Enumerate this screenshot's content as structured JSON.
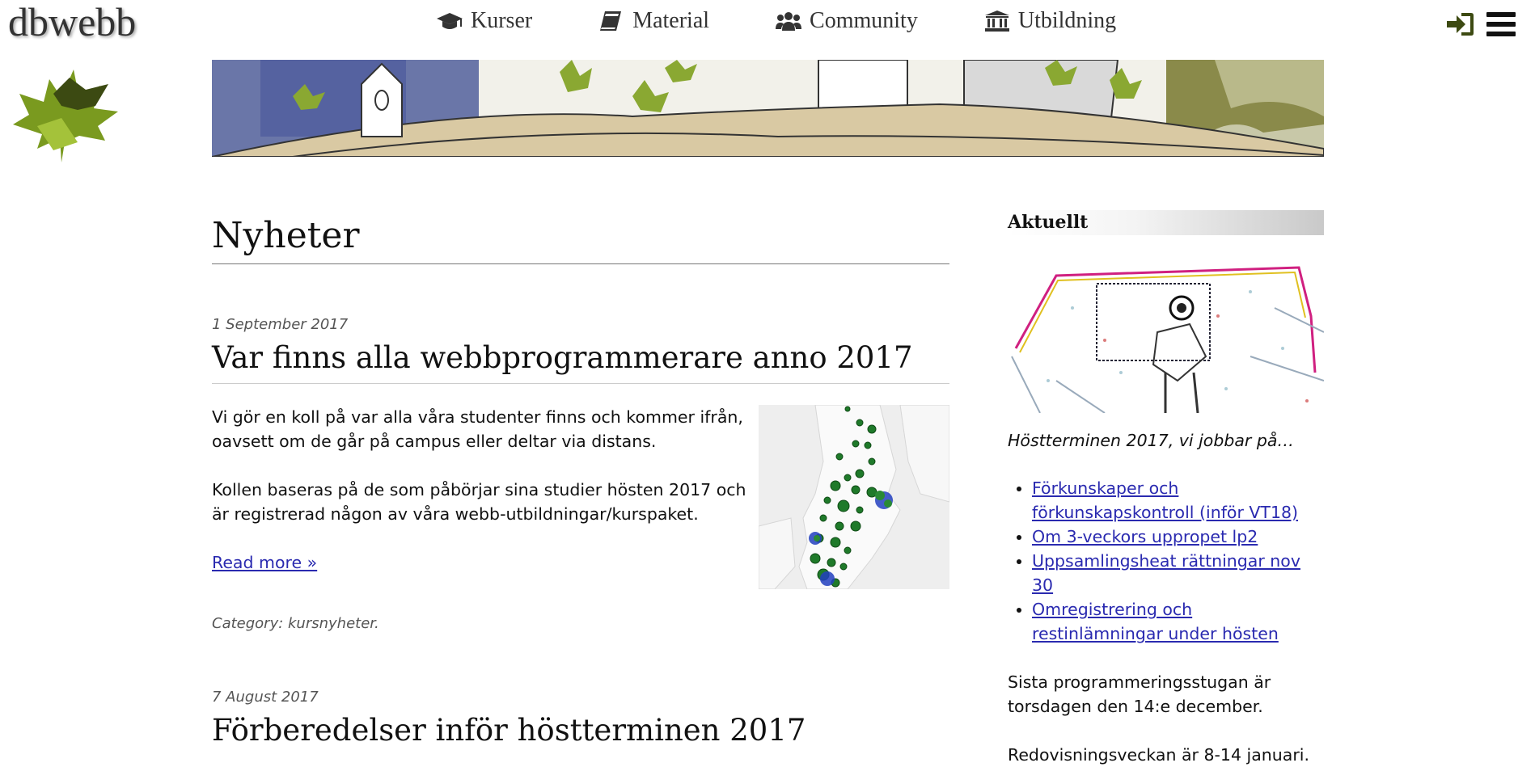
{
  "site": {
    "logo_text": "dbwebb"
  },
  "nav": {
    "items": [
      {
        "label": "Kurser",
        "icon": "graduation-cap-icon"
      },
      {
        "label": "Material",
        "icon": "book-icon"
      },
      {
        "label": "Community",
        "icon": "users-icon"
      },
      {
        "label": "Utbildning",
        "icon": "university-icon"
      }
    ]
  },
  "main": {
    "page_title": "Nyheter",
    "posts": [
      {
        "date": "1 September 2017",
        "title": "Var finns alla webbprogrammerare anno 2017",
        "paragraphs": [
          "Vi gör en koll på var alla våra studenter finns och kommer ifrån, oavsett om de går på campus eller deltar via distans.",
          "Kollen baseras på de som påbörjar sina studier hösten 2017 och är registrerad någon av våra webb-utbildningar/kurspaket."
        ],
        "read_more": "Read more »",
        "category": "Category: kursnyheter."
      },
      {
        "date": "7 August 2017",
        "title": "Förberedelser inför höstterminen 2017"
      }
    ]
  },
  "sidebar": {
    "heading": "Aktuellt",
    "caption": "Höstterminen 2017, vi jobbar på…",
    "links": [
      "Förkunskaper och förkunskapskontroll (inför VT18)",
      "Om 3-veckors uppropet lp2",
      "Uppsamlingsheat rättningar nov 30",
      "Omregistrering och restinlämningar under hösten"
    ],
    "paragraphs": [
      "Sista programmeringsstugan är torsdagen den 14:e december.",
      "Redovisningsveckan är 8-14 januari."
    ]
  },
  "colors": {
    "link": "#2a2ab0",
    "icon_dark": "#333333",
    "login_green": "#3d4a12",
    "map_dot": "#1f7a2a"
  }
}
